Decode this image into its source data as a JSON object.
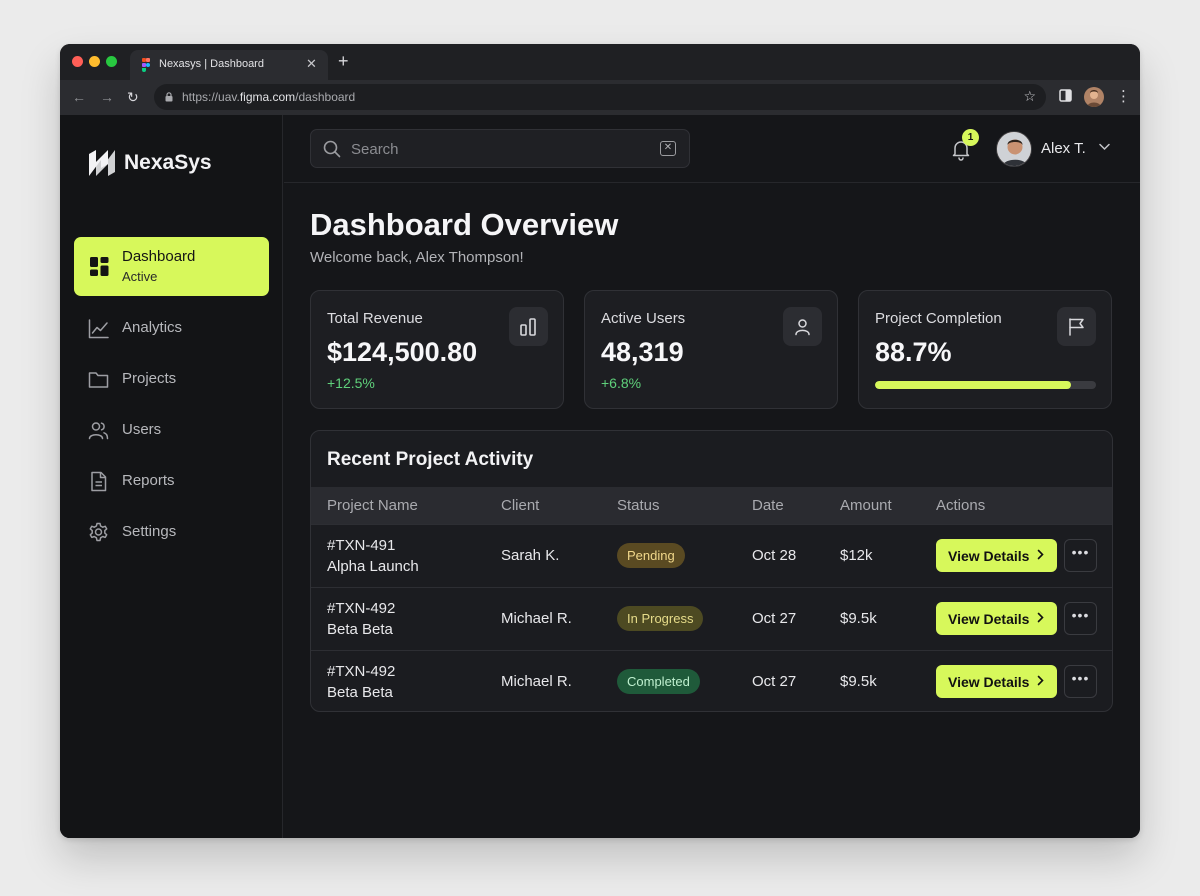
{
  "browser": {
    "tab_title": "Nexasys | Dashboard",
    "url_prefix": "https://uav.",
    "url_domain": "figma.com",
    "url_path": "/dashboard"
  },
  "app": {
    "name": "NexaSys"
  },
  "sidebar": {
    "active": {
      "label": "Dashboard",
      "sublabel": "Active"
    },
    "items": [
      {
        "label": "Analytics",
        "icon": "analytics-icon"
      },
      {
        "label": "Projects",
        "icon": "folder-icon"
      },
      {
        "label": "Users",
        "icon": "users-icon"
      },
      {
        "label": "Reports",
        "icon": "report-icon"
      },
      {
        "label": "Settings",
        "icon": "gear-icon"
      }
    ]
  },
  "header": {
    "search_placeholder": "Search",
    "notification_count": "1",
    "user_name": "Alex T."
  },
  "page": {
    "title": "Dashboard Overview",
    "subtitle": "Welcome back, Alex Thompson!"
  },
  "cards": [
    {
      "label": "Total Revenue",
      "value": "$124,500.80",
      "change": "+12.5%",
      "icon": "bar-chart-icon"
    },
    {
      "label": "Active Users",
      "value": "48,319",
      "change": "+6.8%",
      "icon": "user-icon"
    },
    {
      "label": "Project Completion",
      "value": "88.7%",
      "progress": 0.887,
      "icon": "flag-icon"
    }
  ],
  "table": {
    "title": "Recent Project Activity",
    "columns": [
      "Project Name",
      "Client",
      "Status",
      "Date",
      "Amount",
      "Actions"
    ],
    "rows": [
      {
        "id": "#TXN-491",
        "name": "Alpha Launch",
        "client": "Sarah K.",
        "status": "Pending",
        "date": "Oct 28",
        "amount": "$12k",
        "action": "View Details"
      },
      {
        "id": "#TXN-492",
        "name": "Beta Beta",
        "client": "Michael R.",
        "status": "In Progress",
        "date": "Oct 27",
        "amount": "$9.5k",
        "action": "View Details"
      },
      {
        "id": "#TXN-492",
        "name": "Beta Beta",
        "client": "Michael R.",
        "status": "Completed",
        "date": "Oct 27",
        "amount": "$9.5k",
        "action": "View Details"
      }
    ]
  },
  "colors": {
    "accent": "#d7f85b",
    "positive": "#5fd07b",
    "pending_bg": "#5a4a22",
    "pending_fg": "#f0d78a",
    "progress_bg": "#4d4a22",
    "progress_fg": "#e6dc8a",
    "completed_bg": "#1f5a3a",
    "completed_fg": "#bff0cf"
  }
}
